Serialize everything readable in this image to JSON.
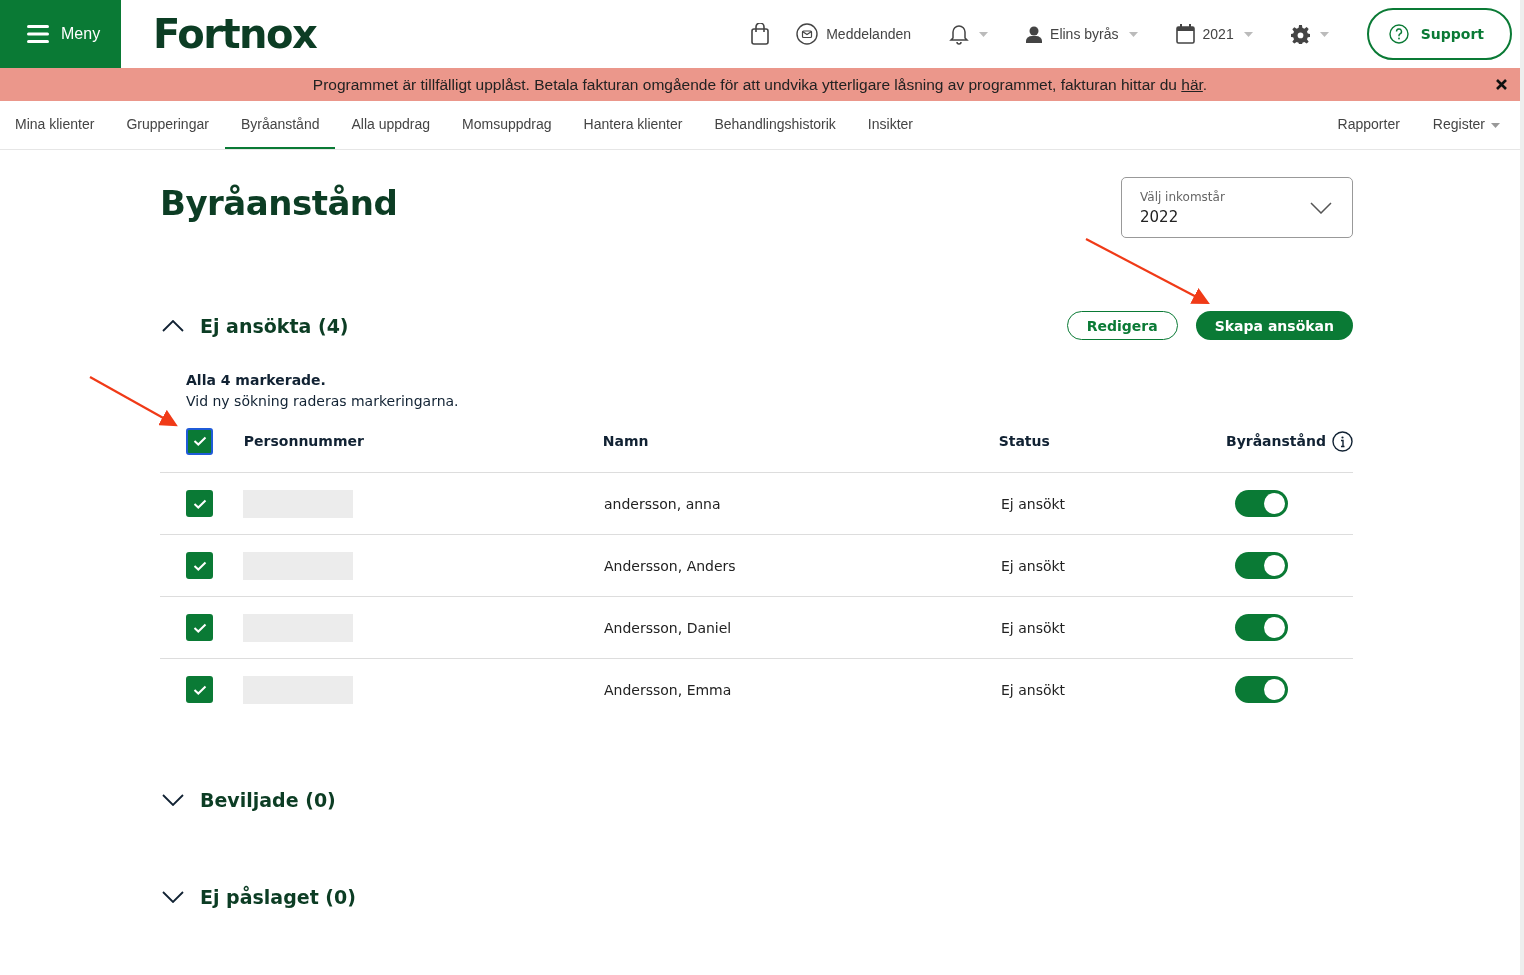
{
  "header": {
    "menu_label": "Meny",
    "logo": "Fortnox",
    "messages": "Meddelanden",
    "bureau": "Elins byrås",
    "year": "2021",
    "support": "Support"
  },
  "banner": {
    "text": "Programmet är tillfälligt upplåst. Betala fakturan omgående för att undvika ytterligare låsning av programmet, fakturan hittar du ",
    "link": "här",
    "end": "."
  },
  "tabs": [
    {
      "label": "Mina klienter",
      "selected": false
    },
    {
      "label": "Grupperingar",
      "selected": false
    },
    {
      "label": "Byråanstånd",
      "selected": true
    },
    {
      "label": "Alla uppdrag",
      "selected": false
    },
    {
      "label": "Momsuppdrag",
      "selected": false
    },
    {
      "label": "Hantera klienter",
      "selected": false
    },
    {
      "label": "Behandlingshistorik",
      "selected": false
    },
    {
      "label": "Insikter",
      "selected": false
    }
  ],
  "right_tabs": [
    {
      "label": "Rapporter",
      "dropdown": false
    },
    {
      "label": "Register",
      "dropdown": true
    }
  ],
  "page": {
    "title": "Byråanstånd",
    "year_select": {
      "label": "Välj inkomstår",
      "value": "2022"
    }
  },
  "sections": [
    {
      "title": "Ej ansökta (4)",
      "expanded": true,
      "buttons": [
        {
          "label": "Redigera",
          "kind": "outline"
        },
        {
          "label": "Skapa ansökan",
          "kind": "primary"
        }
      ],
      "notice": {
        "bold": "Alla 4 markerade.",
        "text": "Vid ny sökning raderas markeringarna."
      },
      "select_all": {
        "checked": true
      },
      "columns": [
        "Personnummer",
        "Namn",
        "Status",
        "Byråanstånd"
      ],
      "rows": [
        {
          "checked": true,
          "name": "andersson, anna",
          "status": "Ej ansökt",
          "on": true
        },
        {
          "checked": true,
          "name": "Andersson, Anders",
          "status": "Ej ansökt",
          "on": true
        },
        {
          "checked": true,
          "name": "Andersson, Daniel",
          "status": "Ej ansökt",
          "on": true
        },
        {
          "checked": true,
          "name": "Andersson, Emma",
          "status": "Ej ansökt",
          "on": true
        }
      ]
    },
    {
      "title": "Beviljade (0)",
      "expanded": false
    },
    {
      "title": "Ej påslaget (0)",
      "expanded": false
    }
  ]
}
